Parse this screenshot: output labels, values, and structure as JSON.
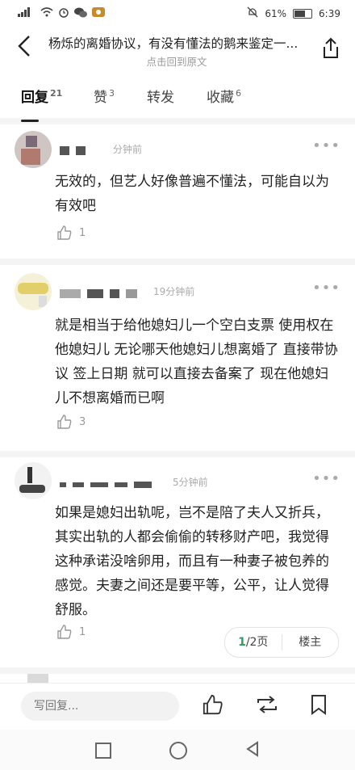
{
  "status": {
    "carrier": "⁴⁶ᵢₗₗ",
    "battery_pct": "61%",
    "time": "6:39"
  },
  "header": {
    "title": "杨烁的离婚协议，有没有懂法的鹅来鉴定一...",
    "subtitle": "点击回到原文"
  },
  "tabs": [
    {
      "label": "回复",
      "count": "21"
    },
    {
      "label": "赞",
      "count": "3"
    },
    {
      "label": "转发",
      "count": ""
    },
    {
      "label": "收藏",
      "count": "6"
    }
  ],
  "comments": [
    {
      "time": "分钟前",
      "text": "无效的，但艺人好像普遍不懂法，可能自以为有效吧",
      "likes": "1"
    },
    {
      "time": "19分钟前",
      "text": "就是相当于给他媳妇儿一个空白支票 使用权在他媳妇儿 无论哪天他媳妇儿想离婚了 直接带协议 签上日期 就可以直接去备案了 现在他媳妇儿不想离婚而已啊",
      "likes": "3"
    },
    {
      "time": "5分钟前",
      "text": "如果是媳妇出轨呢，岂不是陪了夫人又折兵，其实出轨的人都会偷偷的转移财产吧，我觉得这种承诺没啥卵用，而且有一种妻子被包养的感觉。夫妻之间还是要平等，公平，让人觉得舒服。",
      "likes": "1"
    }
  ],
  "pager": {
    "current": "1",
    "total": "/2页",
    "owner": "楼主"
  },
  "reply": {
    "placeholder": "写回复..."
  }
}
